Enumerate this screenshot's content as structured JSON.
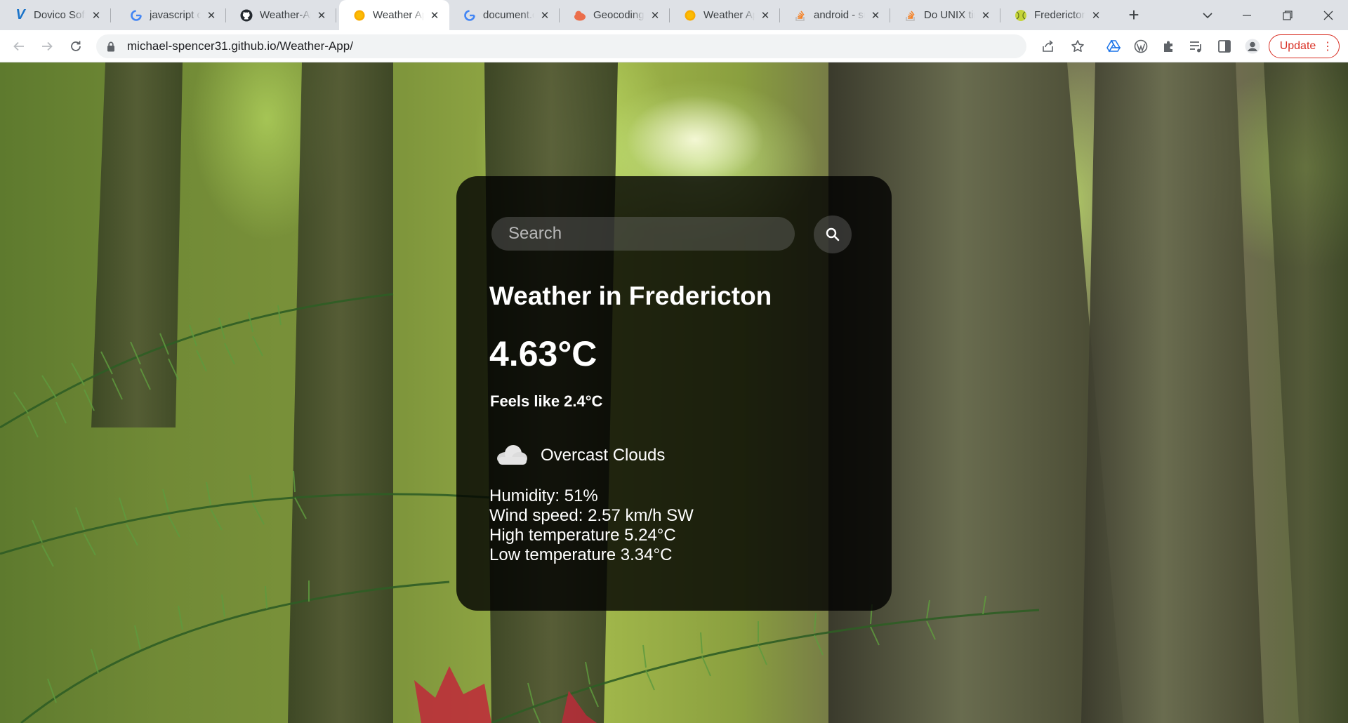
{
  "browser": {
    "tabs": [
      {
        "title": "Dovico Software",
        "favicon": "dovico-v-icon",
        "active": false
      },
      {
        "title": "javascript co",
        "favicon": "google-g-icon",
        "active": false
      },
      {
        "title": "Weather-App",
        "favicon": "github-icon",
        "active": false
      },
      {
        "title": "Weather App",
        "favicon": "sun-icon",
        "active": true
      },
      {
        "title": "document.c",
        "favicon": "google-g-icon",
        "active": false
      },
      {
        "title": "Geocoding",
        "favicon": "openweather-icon",
        "active": false
      },
      {
        "title": "Weather App",
        "favicon": "sun-icon",
        "active": false
      },
      {
        "title": "android - su",
        "favicon": "stackoverflow-icon",
        "active": false
      },
      {
        "title": "Do UNIX tim",
        "favicon": "stackoverflow-icon",
        "active": false
      },
      {
        "title": "Fredericton",
        "favicon": "tennis-ball-icon",
        "active": false
      }
    ],
    "url": "michael-spencer31.github.io/Weather-App/",
    "update_label": "Update",
    "accent_color": "#d93025"
  },
  "weather": {
    "search_placeholder": "Search",
    "city_title": "Weather in Fredericton",
    "temperature": "4.63°C",
    "feels_like": "Feels like 2.4°C",
    "condition_icon": "cloud-icon",
    "condition": "Overcast Clouds",
    "details": [
      "Humidity: 51%",
      "Wind speed: 2.57 km/h SW",
      "High temperature 5.24°C",
      "Low temperature 3.34°C"
    ]
  }
}
